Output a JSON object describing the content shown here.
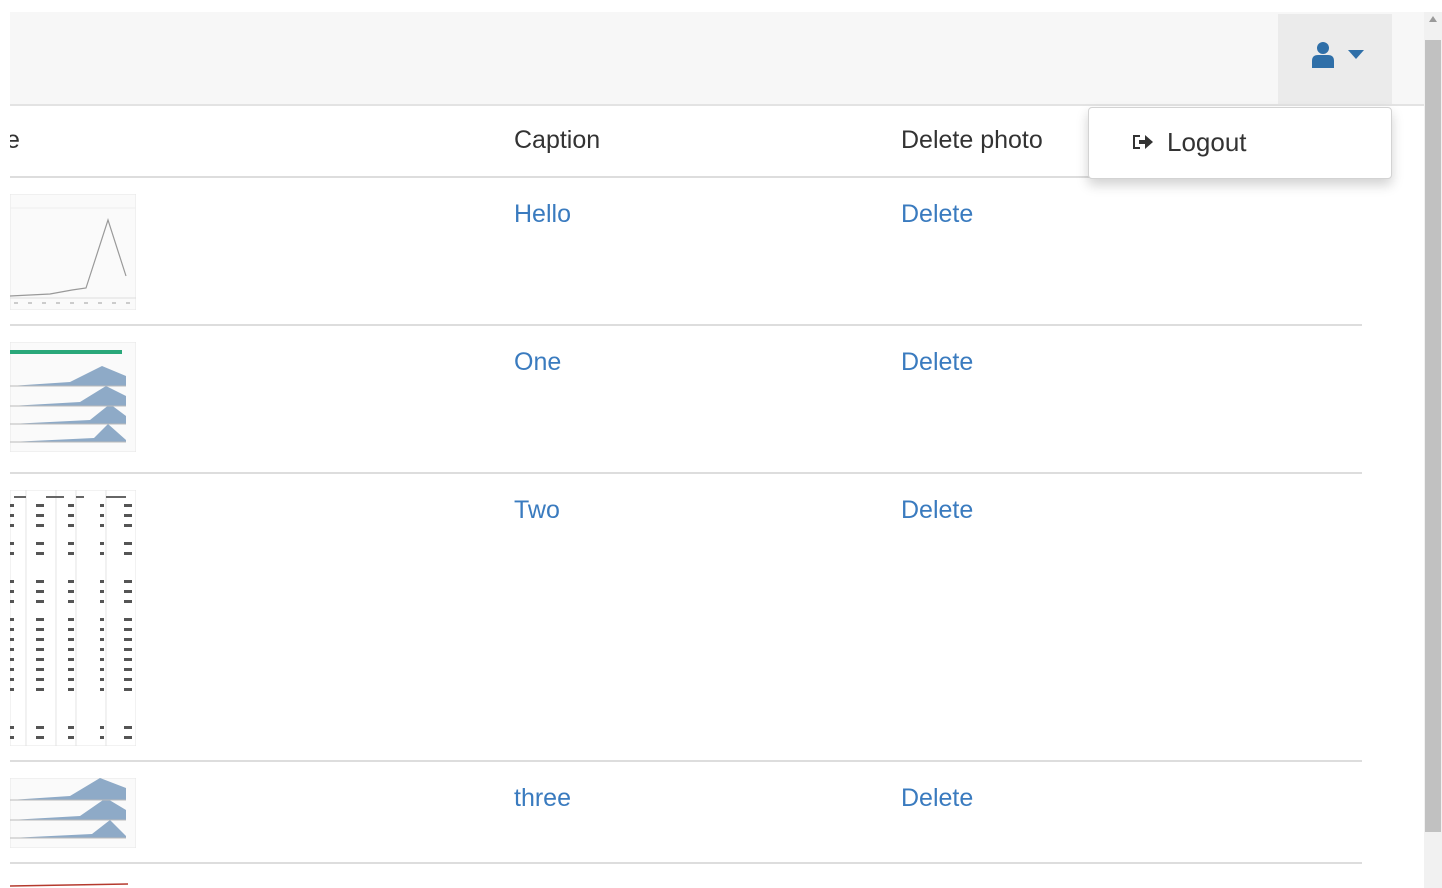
{
  "navbar": {
    "user_menu": {
      "icon": "user-icon",
      "caret_icon": "caret-down-icon"
    },
    "dropdown": {
      "items": [
        {
          "label": "Logout",
          "icon": "logout-icon"
        }
      ]
    }
  },
  "table": {
    "headers": {
      "image": "e",
      "caption": "Caption",
      "delete": "Delete photo"
    },
    "rows": [
      {
        "thumb": "line-chart-thumbnail",
        "caption": "Hello",
        "delete": "Delete"
      },
      {
        "thumb": "area-chart-thumbnail",
        "caption": "One",
        "delete": "Delete"
      },
      {
        "thumb": "spreadsheet-thumbnail",
        "caption": "Two",
        "delete": "Delete"
      },
      {
        "thumb": "area-chart-thumbnail",
        "caption": "three",
        "delete": "Delete"
      }
    ]
  },
  "colors": {
    "link": "#3a7bbf",
    "navbar_bg": "#f7f7f7",
    "thumb_fill": "#8eaac7"
  }
}
